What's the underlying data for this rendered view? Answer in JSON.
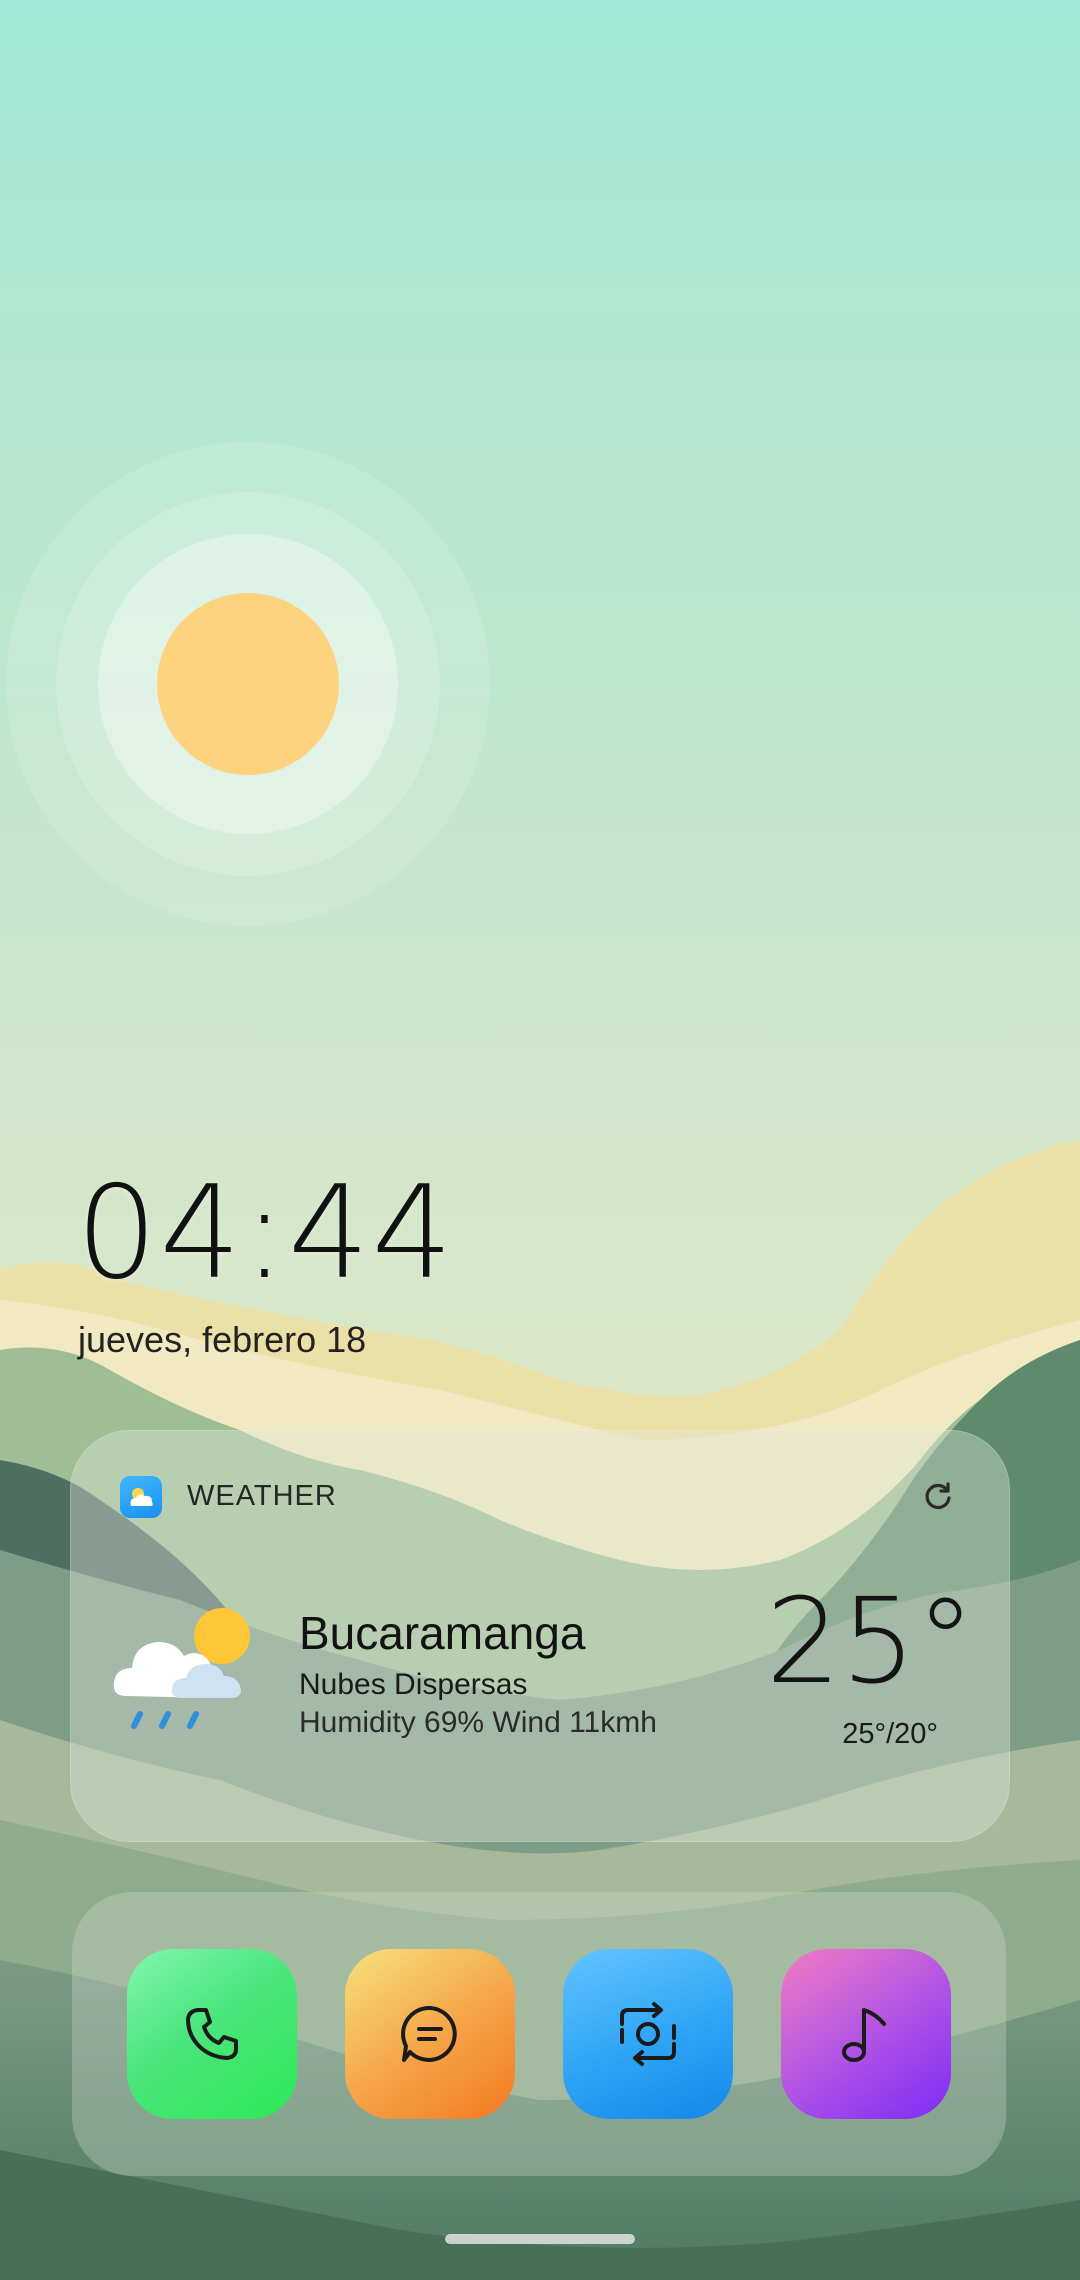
{
  "lockscreen": {
    "time": "04:44",
    "date": "jueves, febrero 18"
  },
  "weather_widget": {
    "label": "WEATHER",
    "city": "Bucaramanga",
    "condition": "Nubes Dispersas",
    "details": "Humidity 69% Wind 11kmh",
    "temperature": "25°",
    "range": "25°/20°",
    "icons": {
      "app": "weather-app-icon",
      "refresh": "refresh-icon",
      "condition": "cloud-sun-rain-icon"
    }
  },
  "dock": {
    "apps": [
      {
        "name": "phone",
        "icon": "phone-icon",
        "color": "#3ee864"
      },
      {
        "name": "messages",
        "icon": "message-icon",
        "color": "#f5962e"
      },
      {
        "name": "camera",
        "icon": "camera-icon",
        "color": "#2ea4f5"
      },
      {
        "name": "music",
        "icon": "music-icon",
        "color": "#9a3cf0"
      }
    ]
  },
  "colors": {
    "sky_top": "#a3e9d7",
    "sun": "#fed37f"
  }
}
